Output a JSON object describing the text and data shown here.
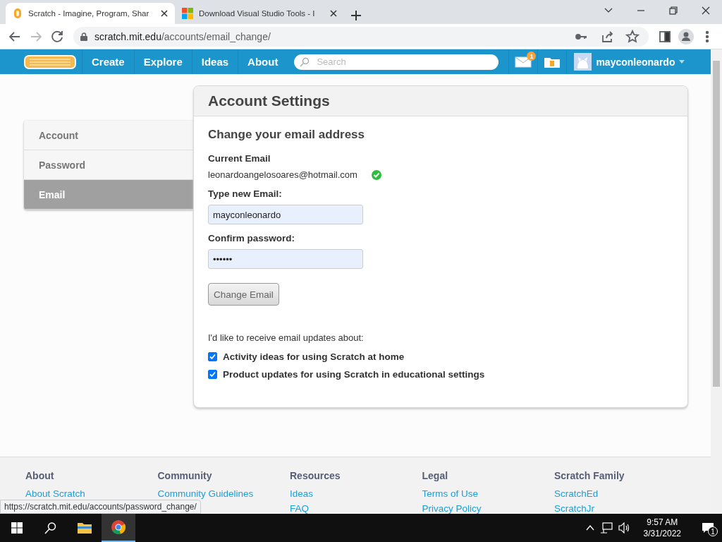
{
  "browser": {
    "tabs": [
      {
        "title": "Scratch - Imagine, Program, Shar",
        "selected": true,
        "kind": "scratch"
      },
      {
        "title": "Download Visual Studio Tools - I",
        "selected": false,
        "kind": "windows"
      }
    ],
    "address": {
      "host": "scratch.mit.edu",
      "path": "/accounts/email_change/"
    }
  },
  "navbar": {
    "links": [
      "Create",
      "Explore",
      "Ideas",
      "About"
    ],
    "search": {
      "placeholder": "Search"
    },
    "message_count": "1",
    "username": "mayconleonardo"
  },
  "sidebar": {
    "items": [
      {
        "label": "Account",
        "selected": false
      },
      {
        "label": "Password",
        "selected": false
      },
      {
        "label": "Email",
        "selected": true
      }
    ]
  },
  "settings": {
    "title": "Account Settings",
    "heading": "Change your email address",
    "current_email_label": "Current Email",
    "current_email": "leonardoangelosoares@hotmail.com",
    "verified": true,
    "new_email_label": "Type new Email:",
    "new_email_value": "mayconleonardo",
    "password_label": "Confirm password:",
    "password_value": "••••••",
    "button": "Change Email",
    "updates_prompt": "I'd like to receive email updates about:",
    "options": [
      {
        "label": "Activity ideas for using Scratch at home",
        "checked": true
      },
      {
        "label": "Product updates for using Scratch in educational settings",
        "checked": true
      }
    ]
  },
  "footer": {
    "columns": [
      {
        "heading": "About",
        "links": [
          "About Scratch"
        ]
      },
      {
        "heading": "Community",
        "links": [
          "Community Guidelines"
        ]
      },
      {
        "heading": "Resources",
        "links": [
          "Ideas",
          "FAQ"
        ]
      },
      {
        "heading": "Legal",
        "links": [
          "Terms of Use",
          "Privacy Policy"
        ]
      },
      {
        "heading": "Scratch Family",
        "links": [
          "ScratchEd",
          "ScratchJr"
        ]
      }
    ]
  },
  "status_url": "https://scratch.mit.edu/accounts/password_change/",
  "taskbar": {
    "time": "9:57 AM",
    "date": "3/31/2022",
    "notification_count": "1"
  }
}
